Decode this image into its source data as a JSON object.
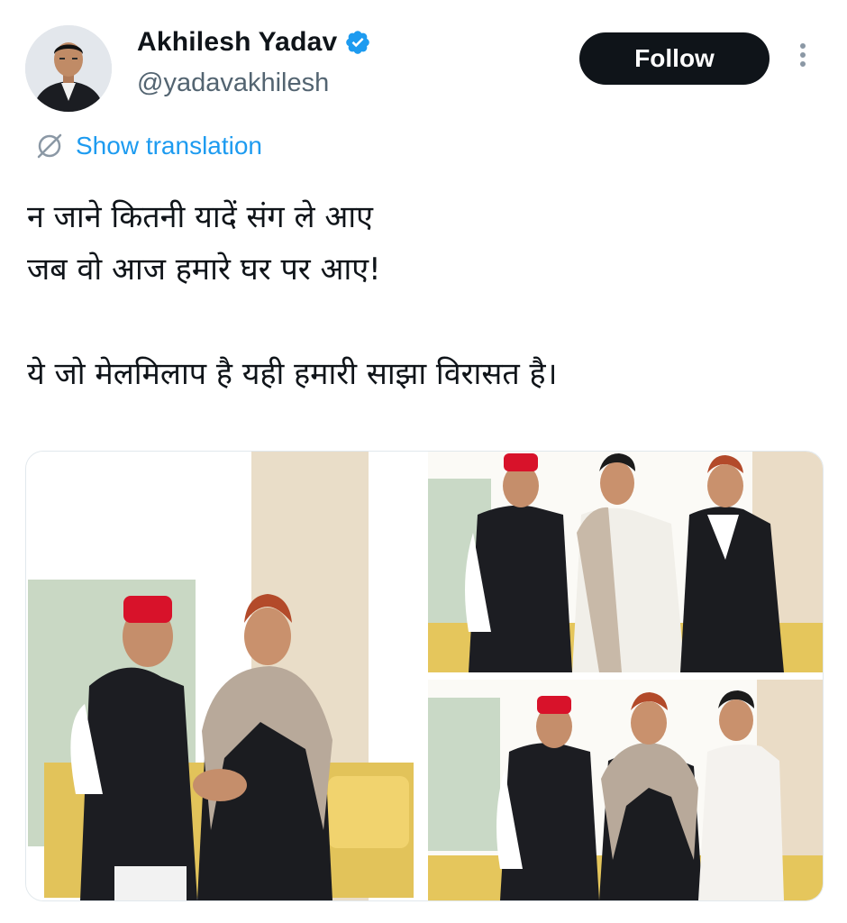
{
  "author": {
    "display_name": "Akhilesh Yadav",
    "handle": "@yadavakhilesh",
    "verified": true
  },
  "actions": {
    "follow_label": "Follow",
    "more_icon": "more-vertical-icon"
  },
  "translation": {
    "label": "Show translation",
    "icon": "translate-icon"
  },
  "tweet": {
    "text": "न जाने कितनी यादें संग ले आए\nजब वो आज हमारे घर पर आए!\n\nये जो मेलमिलाप है यही हमारी साझा विरासत है।"
  },
  "media": {
    "count": 3
  },
  "colors": {
    "accent": "#1d9bf0",
    "button_bg": "#0f1419",
    "text_secondary": "#536471"
  }
}
